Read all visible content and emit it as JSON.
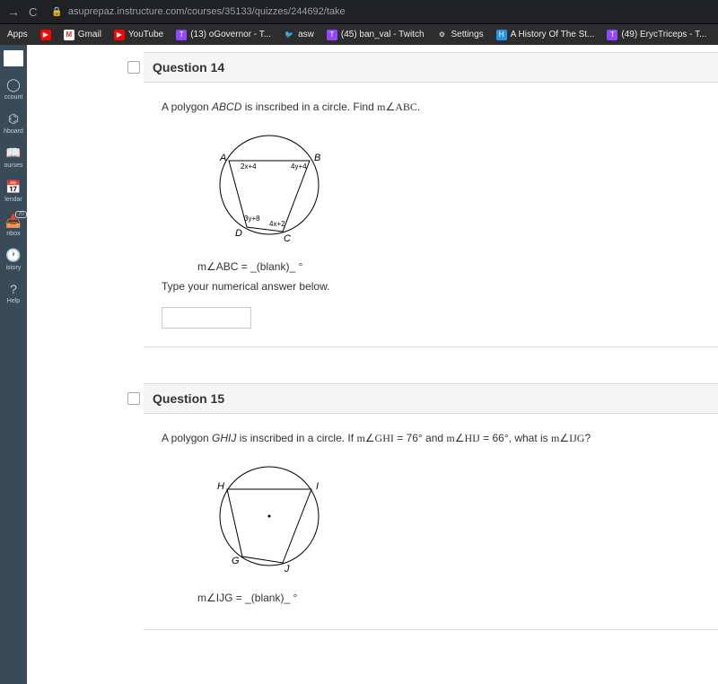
{
  "browser": {
    "url": "asuprepaz.instructure.com/courses/35133/quizzes/244692/take"
  },
  "bookmarks": {
    "apps": "Apps",
    "gmail": "Gmail",
    "youtube": "YouTube",
    "ogovernor": "(13) oGovernor - T...",
    "asw": "asw",
    "banval": "(45) ban_val - Twitch",
    "settings": "Settings",
    "history": "A History Of The St...",
    "eryc": "(49) ErycTriceps - T..."
  },
  "sidebar": {
    "account": "ccount",
    "dashboard": "hboard",
    "courses": "ourses",
    "calendar": "lendar",
    "inbox": "nbox",
    "inbox_count": "70",
    "history_label": "istory",
    "help": "Help"
  },
  "q14": {
    "title": "Question 14",
    "prompt_pre": "A polygon ",
    "prompt_poly": "ABCD",
    "prompt_mid": " is inscribed in a circle. Find ",
    "prompt_angle": "m∠ABC",
    "prompt_end": ".",
    "labelA": "A",
    "labelB": "B",
    "labelC": "C",
    "labelD": "D",
    "arcAB": "2x+4",
    "arcBC": "4y+4",
    "arcCD": "4x+2",
    "arcDA": "3y+8",
    "formula": "m∠ABC = _(blank)_ °",
    "instruction": "Type your numerical answer below."
  },
  "q15": {
    "title": "Question 15",
    "prompt_pre": "A polygon ",
    "prompt_poly": "GHIJ",
    "prompt_mid": " is inscribed in a circle. If ",
    "ang1_lbl": "m∠GHI",
    "ang1_val": " = 76°",
    "and": " and ",
    "ang2_lbl": "m∠HIJ",
    "ang2_val": " = 66°",
    "prompt_q": ", what is ",
    "ang3_lbl": "m∠IJG",
    "prompt_end": "?",
    "labelG": "G",
    "labelH": "H",
    "labelI": "I",
    "labelJ": "J",
    "formula": "m∠IJG = _(blank)_ °"
  }
}
